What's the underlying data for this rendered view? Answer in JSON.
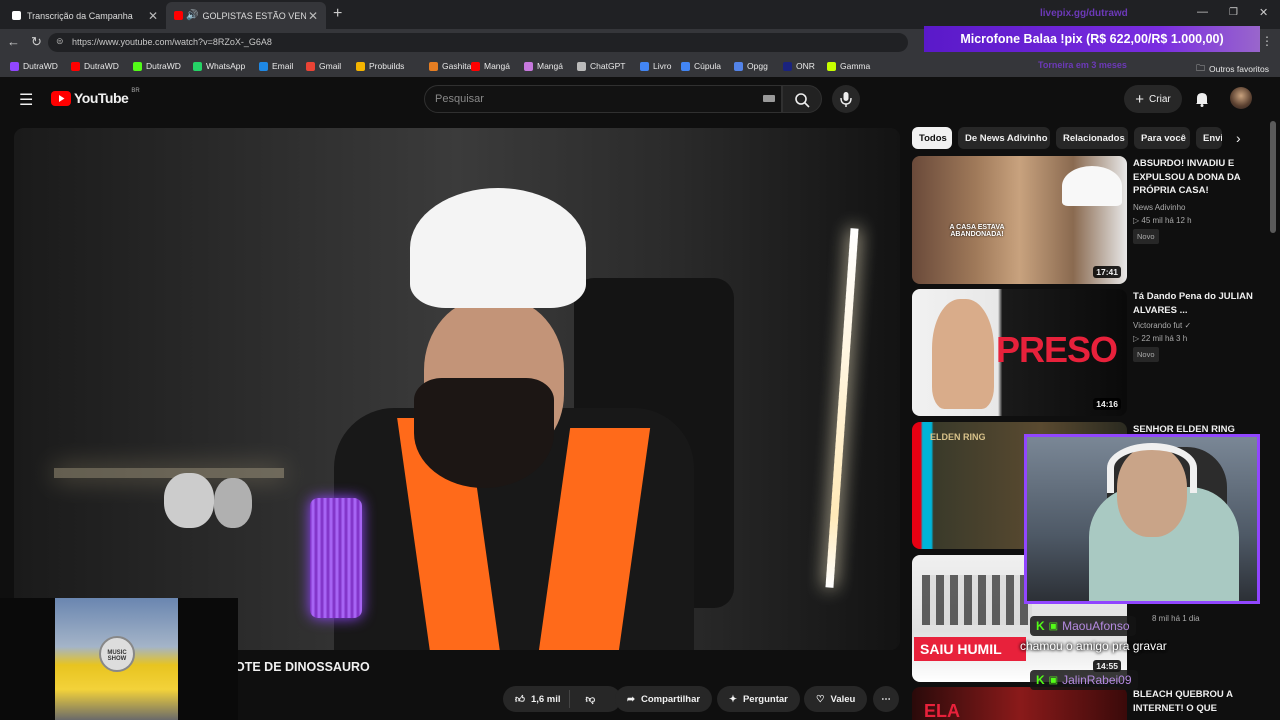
{
  "browser": {
    "tabs": [
      {
        "title": "Transcrição da Campanha"
      },
      {
        "title": "GOLPISTAS ESTÃO VENDEND"
      }
    ],
    "url": "https://www.youtube.com/watch?v=8RZoX-_G6A8",
    "bookmarks": [
      {
        "label": "DutraWD",
        "color": "#9146ff"
      },
      {
        "label": "DutraWD",
        "color": "#ff0000"
      },
      {
        "label": "DutraWD",
        "color": "#53fc18"
      },
      {
        "label": "WhatsApp",
        "color": "#25d366"
      },
      {
        "label": "Email",
        "color": "#1e88e5"
      },
      {
        "label": "Gmail",
        "color": "#ea4335"
      },
      {
        "label": "Probuilds",
        "color": "#f4b400"
      },
      {
        "label": "Gashita",
        "color": "#e67e22"
      },
      {
        "label": "Mangá",
        "color": "#ff0000"
      },
      {
        "label": "Mangá",
        "color": "#c678dd"
      },
      {
        "label": "ChatGPT",
        "color": "#bbbbbb"
      },
      {
        "label": "Livro",
        "color": "#4285f4"
      },
      {
        "label": "Cúpula",
        "color": "#4285f4"
      },
      {
        "label": "Opgg",
        "color": "#5383e8"
      },
      {
        "label": "ONR",
        "color": "#1a237e"
      },
      {
        "label": "Gamma",
        "color": "#c6ff00"
      }
    ],
    "other_bookmarks": "Outros favoritos"
  },
  "overlay": {
    "donation_goal": "Microfone Balaa !pix (R$ 622,00/R$ 1.000,00)",
    "donation_progress": 0.622,
    "faint_top": "livepix.gg/dutrawd",
    "faint_sub": "Torneira em 3 meses",
    "chat": [
      {
        "user": "MaouAfonso",
        "message": "chamou o amigo pra gravar"
      },
      {
        "user": "JalinRabei09"
      }
    ],
    "music_label": "MUSIC SHOW"
  },
  "youtube": {
    "logo": "YouTube",
    "region": "BR",
    "search_placeholder": "Pesquisar",
    "create_label": "Criar",
    "video_title_fragment": "OTE DE DINOSSAURO",
    "actions": {
      "likes": "1,6 mil",
      "share": "Compartilhar",
      "ask": "Perguntar",
      "thanks": "Valeu"
    },
    "chips": [
      "Todos",
      "De News Adivinho",
      "Relacionados",
      "Para você",
      "Envi"
    ],
    "recommendations": [
      {
        "title": "ABSURDO! INVADIU E EXPULSOU A DONA DA PRÓPRIA CASA!",
        "channel": "News Adivinho",
        "stats": "45 mil há 12 h",
        "badge": "Novo",
        "duration": "17:41",
        "thumb_text": "A CASA ESTAVA ABANDONADA!"
      },
      {
        "title": "Tá Dando Pena do JULIAN ALVARES ...",
        "channel": "Victorando fut",
        "stats": "22 mil há 3 h",
        "badge": "Novo",
        "duration": "14:16",
        "thumb_text": "PRESO"
      },
      {
        "title": "SENHOR ELDEN RING",
        "thumb_text": "ELDEN RING"
      },
      {
        "stats": "8 mil há 1 dia",
        "duration": "14:55",
        "thumb_text": "SAIU HUMIL"
      },
      {
        "title": "BLEACH QUEBROU A INTERNET! O QUE",
        "thumb_text": "ELA"
      }
    ]
  }
}
